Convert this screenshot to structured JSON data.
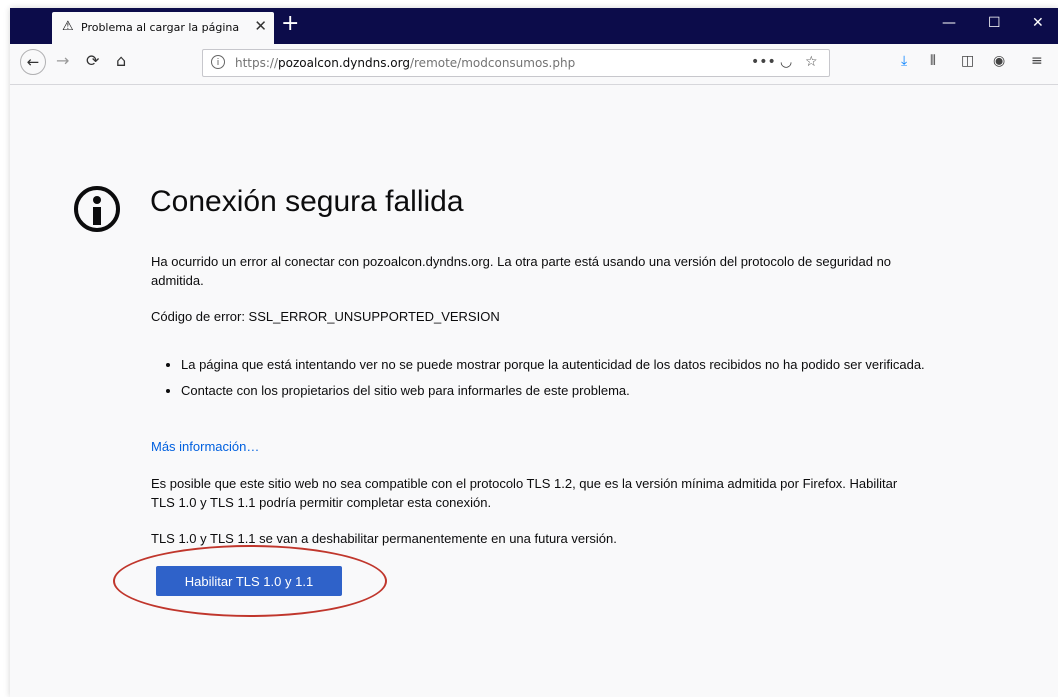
{
  "tab": {
    "title": "Problema al cargar la página",
    "warning_icon": "warning-icon",
    "close": "✕"
  },
  "toolbar": {
    "url_scheme": "https://",
    "url_host": "pozoalcon.dyndns.org",
    "url_path": "/remote/modconsumos.php",
    "page_actions": "•••"
  },
  "error": {
    "title": "Conexión segura fallida",
    "desc": "Ha ocurrido un error al conectar con pozoalcon.dyndns.org. La otra parte está usando una versión del protocolo de seguridad no admitida.",
    "code": "Código de error: SSL_ERROR_UNSUPPORTED_VERSION",
    "reasons": [
      "La página que está intentando ver no se puede mostrar porque la autenticidad de los datos recibidos no ha podido ser verificada.",
      "Contacte con los propietarios del sitio web para informarles de este problema."
    ],
    "more_info": "Más información…",
    "tls_note": "Es posible que este sitio web no sea compatible con el protocolo TLS 1.2, que es la versión mínima admitida por Firefox. Habilitar TLS 1.0 y TLS 1.1 podría permitir completar esta conexión.",
    "deprecation": "TLS 1.0 y TLS 1.1 se van a deshabilitar permanentemente en una futura versión.",
    "button": "Habilitar TLS 1.0 y 1.1"
  },
  "colors": {
    "tabbar": "#0c0c4a",
    "button": "#2f62c9",
    "link": "#0060df",
    "annotation": "#c0362c"
  }
}
